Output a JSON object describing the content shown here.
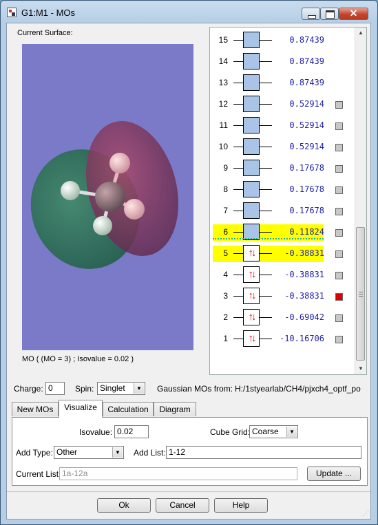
{
  "window": {
    "title": "G1:M1 - MOs",
    "close_glyph": "✕"
  },
  "surface": {
    "label": "Current Surface:",
    "caption": "MO ( (MO = 3) ; Isovalue = 0.02 )"
  },
  "mos": [
    {
      "num": "15",
      "energy": "0.87439",
      "occupied": false,
      "checkbox": false,
      "checked": false,
      "highlight": false
    },
    {
      "num": "14",
      "energy": "0.87439",
      "occupied": false,
      "checkbox": false,
      "checked": false,
      "highlight": false
    },
    {
      "num": "13",
      "energy": "0.87439",
      "occupied": false,
      "checkbox": false,
      "checked": false,
      "highlight": false
    },
    {
      "num": "12",
      "energy": "0.52914",
      "occupied": false,
      "checkbox": true,
      "checked": false,
      "highlight": false
    },
    {
      "num": "11",
      "energy": "0.52914",
      "occupied": false,
      "checkbox": true,
      "checked": false,
      "highlight": false
    },
    {
      "num": "10",
      "energy": "0.52914",
      "occupied": false,
      "checkbox": true,
      "checked": false,
      "highlight": false
    },
    {
      "num": "9",
      "energy": "0.17678",
      "occupied": false,
      "checkbox": true,
      "checked": false,
      "highlight": false
    },
    {
      "num": "8",
      "energy": "0.17678",
      "occupied": false,
      "checkbox": true,
      "checked": false,
      "highlight": false
    },
    {
      "num": "7",
      "energy": "0.17678",
      "occupied": false,
      "checkbox": true,
      "checked": false,
      "highlight": false
    },
    {
      "num": "6",
      "energy": "0.11824",
      "occupied": false,
      "checkbox": true,
      "checked": false,
      "highlight": true
    },
    {
      "num": "5",
      "energy": "-0.38831",
      "occupied": true,
      "checkbox": true,
      "checked": false,
      "highlight": true
    },
    {
      "num": "4",
      "energy": "-0.38831",
      "occupied": true,
      "checkbox": true,
      "checked": false,
      "highlight": false
    },
    {
      "num": "3",
      "energy": "-0.38831",
      "occupied": true,
      "checkbox": true,
      "checked": true,
      "highlight": false
    },
    {
      "num": "2",
      "energy": "-0.69042",
      "occupied": true,
      "checkbox": true,
      "checked": false,
      "highlight": false
    },
    {
      "num": "1",
      "energy": "-10.16706",
      "occupied": true,
      "checkbox": true,
      "checked": false,
      "highlight": false
    }
  ],
  "spin_glyph": "↑↓",
  "settings": {
    "charge_label": "Charge:",
    "charge_value": "0",
    "spin_label": "Spin:",
    "spin_value": "Singlet",
    "source_label": "Gaussian MOs from:",
    "source_path": "H:/1styearlab/CH4/pjxch4_optf_po"
  },
  "tabs": [
    "New MOs",
    "Visualize",
    "Calculation",
    "Diagram"
  ],
  "visualize": {
    "isovalue_label": "Isovalue:",
    "isovalue_value": "0.02",
    "cube_grid_label": "Cube Grid:",
    "cube_grid_value": "Coarse",
    "add_type_label": "Add Type:",
    "add_type_value": "Other",
    "add_list_label": "Add List:",
    "add_list_value": "1-12",
    "current_list_label": "Current List:",
    "current_list_value": "1a-12a",
    "update_button": "Update ..."
  },
  "buttons": {
    "ok": "Ok",
    "cancel": "Cancel",
    "help": "Help"
  },
  "icons": {
    "dropdown": "▼",
    "scroll_up": "▲",
    "scroll_down": "▼",
    "resize": "⋰"
  }
}
